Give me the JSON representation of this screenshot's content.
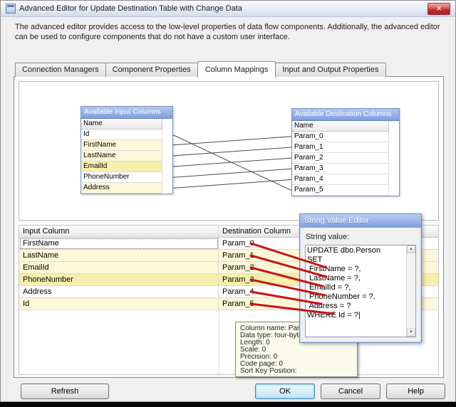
{
  "window": {
    "title": "Advanced Editor for Update Destination Table with Change Data",
    "description": "The advanced editor provides access to the low-level properties of data flow components. Additionally, the advanced editor can be used to configure components that do not have a custom user interface."
  },
  "icons": {
    "close": "✕",
    "scroll_up": "▲",
    "scroll_down": "▼"
  },
  "colors": {
    "accent-blue": "#7d9fe0",
    "arrow-red": "#c81414",
    "row-yellow": "#fdf8d7",
    "row-yellow-strong": "#f7efad",
    "tooltip-bg": "#fbfbec"
  },
  "tabs": [
    {
      "label": "Connection Managers",
      "selected": false
    },
    {
      "label": "Component Properties",
      "selected": false
    },
    {
      "label": "Column Mappings",
      "selected": true
    },
    {
      "label": "Input and Output Properties",
      "selected": false
    }
  ],
  "input_columns_box": {
    "title": "Available Input Columns",
    "header": "Name",
    "rows": [
      "Id",
      "FirstName",
      "LastName",
      "EmailId",
      "PhoneNumber",
      "Address"
    ]
  },
  "destination_columns_box": {
    "title": "Available Destination Columns",
    "header": "Name",
    "rows": [
      "Param_0",
      "Param_1",
      "Param_2",
      "Param_3",
      "Param_4",
      "Param_5"
    ]
  },
  "mapping_grid": {
    "col1": "Input Column",
    "col2": "Destination Column",
    "rows": [
      {
        "input": "FirstName",
        "dest": "Param_0"
      },
      {
        "input": "LastName",
        "dest": "Param_1"
      },
      {
        "input": "EmailId",
        "dest": "Param_2"
      },
      {
        "input": "PhoneNumber",
        "dest": "Param_3"
      },
      {
        "input": "Address",
        "dest": "Param_4"
      },
      {
        "input": "Id",
        "dest": "Param_5"
      }
    ]
  },
  "string_value_editor": {
    "title": "String Value Editor",
    "label": "String value:",
    "lines": [
      "UPDATE dbo.Person",
      "SET",
      " FirstName = ?,",
      " LastName = ?,",
      " EmailId = ?,",
      " PhoneNumber = ?,",
      " Address = ?",
      "WHERE Id = ?|"
    ]
  },
  "tooltip": {
    "lines": [
      "Column name: Param",
      "Data type: four-byte",
      "Length: 0",
      "Scale: 0",
      "Precision: 0",
      "Code page: 0",
      "Sort Key Position:"
    ]
  },
  "buttons": {
    "refresh": "Refresh",
    "ok": "OK",
    "cancel": "Cancel",
    "help": "Help"
  }
}
